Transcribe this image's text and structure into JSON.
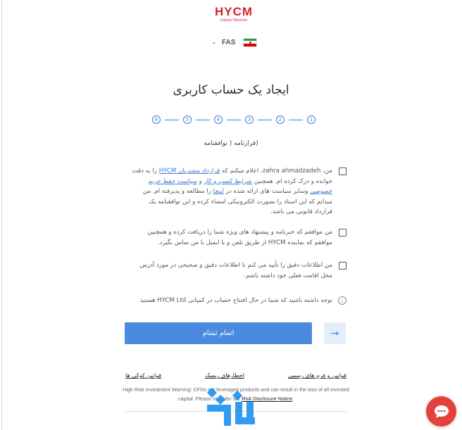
{
  "brand": {
    "name": "HYCM",
    "tagline": "Capital Markets",
    "color": "#d8202c"
  },
  "language": {
    "code": "FAS",
    "flag": "iran-flag"
  },
  "page": {
    "title": "ایجاد یک حساب کاربری",
    "subtitle": "(قرارنامه ( توافقنامه"
  },
  "steps": [
    "6",
    "5",
    "4",
    "3",
    "2",
    "1"
  ],
  "agreements": [
    {
      "p1": "من، ",
      "name": "zahra ahmadzadeh",
      "p2": "، اعلام میکنم که ",
      "link1": "قرارداد مشتریان HYCM",
      "p3": " را به دقت خوانده و درک کرده ام. همچنین ",
      "link2": "شرایط کسب و کار",
      "p4": " و ",
      "link3": "سیاست حفظ حریم خصوصی",
      "p5": " وسایر سیاست های ارائه شده در ",
      "link4": "اینجا",
      "p6": " را مطالعه و پذیرفته ام. من میدانم که این اسناد را بصورت الکترونیکی امضاء کرده و این توافقنامه یک قرارداد قانونی می باشد."
    },
    {
      "text": "من موافقم که خبرنامه و پیشنهاد های ویژه شما را دریافت کرده و همچنین موافقم که نماینده HYCM از طریق تلفن و یا ایمیل با من تماس بگیرد."
    },
    {
      "text": "من اطلاعات دقیق را تأیید می کنم تا اطلاعات دقیق و صحیحی در مورد آدرس محل اقامت فعلی خود داشته باشم."
    }
  ],
  "notice": {
    "text": "توجه داشته باشید که شما در حال افتتاح حساب در کمپانی HYCM Ltd هستید"
  },
  "buttons": {
    "submit": "اتمام ثبتنام",
    "back_icon": "arrow-right-icon"
  },
  "footer": {
    "links": [
      "قوانین و فرم های رسمی",
      "اخطارهای ریسک",
      "قوانین کوکی ها"
    ],
    "warning_p1": "High Risk Investment Warning: CFDs are leveraged products and can result in the loss of all invested capital. Please consider our ",
    "warning_link": "Risk Disclosure Notice",
    "warning_p2": "."
  },
  "colors": {
    "accent": "#4a8be0",
    "chat": "#e5413c"
  }
}
